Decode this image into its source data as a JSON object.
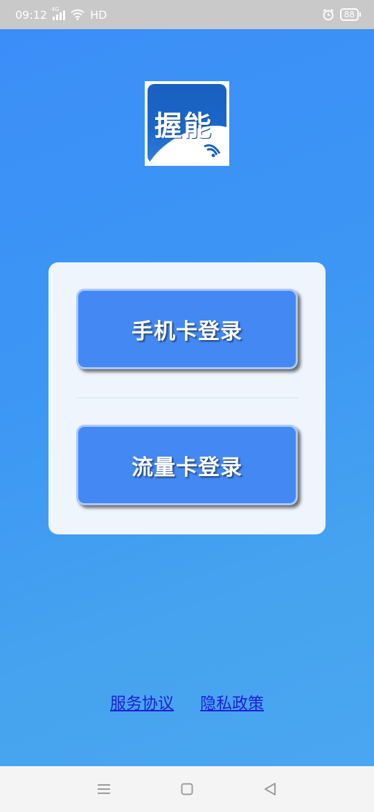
{
  "status_bar": {
    "time": "09:12",
    "network_type": "4G",
    "hd_label": "HD",
    "battery": "88",
    "icons": [
      "signal-icon",
      "wifi-icon",
      "alarm-icon",
      "battery-icon"
    ]
  },
  "logo": {
    "text": "握能",
    "icon": "app-logo-icon"
  },
  "login_card": {
    "sim_login_label": "手机卡登录",
    "data_login_label": "流量卡登录"
  },
  "footer_links": {
    "service_agreement": "服务协议",
    "privacy_policy": "隐私政策"
  },
  "nav_bar": {
    "icons": [
      "menu-icon",
      "home-icon",
      "back-icon"
    ]
  },
  "colors": {
    "background": "#3a94f3",
    "button": "#4488f3",
    "card": "#eef5fc",
    "link": "#1b1fd8",
    "status_bar": "#c9c9c9"
  }
}
